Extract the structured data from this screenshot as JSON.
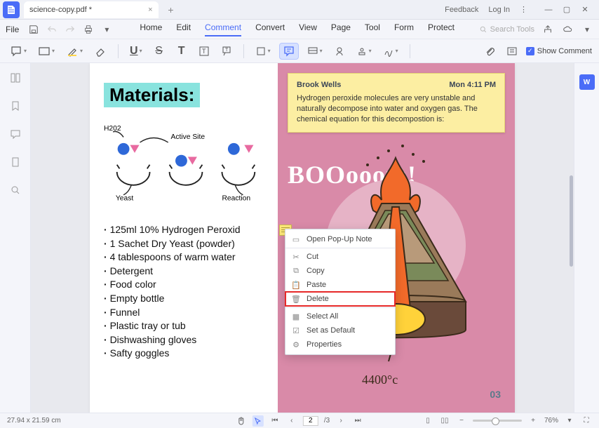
{
  "title_bar": {
    "tab_name": "science-copy.pdf *",
    "feedback": "Feedback",
    "login": "Log In"
  },
  "menubar": {
    "file": "File",
    "tabs": {
      "home": "Home",
      "edit": "Edit",
      "comment": "Comment",
      "convert": "Convert",
      "view": "View",
      "page": "Page",
      "tool": "Tool",
      "form": "Form",
      "protect": "Protect"
    },
    "search_placeholder": "Search Tools"
  },
  "toolbar": {
    "show_comment": "Show Comment"
  },
  "document": {
    "heading": "Materials:",
    "sketch_labels": {
      "h2o2": "H202",
      "active_site": "Active Site",
      "yeast": "Yeast",
      "reaction": "Reaction"
    },
    "list": [
      "125ml 10% Hydrogen Peroxid",
      "1 Sachet Dry Yeast (powder)",
      "4 tablespoons of warm water",
      "Detergent",
      "Food color",
      "Empty bottle",
      "Funnel",
      "Plastic tray or tub",
      "Dishwashing gloves",
      "Safty goggles"
    ],
    "note": {
      "author": "Brook Wells",
      "time": "Mon 4:11 PM",
      "body": "Hydrogen peroxide molecules are very unstable and naturally decompose into water and oxygen gas. The chemical equation for this decompostion is:"
    },
    "boom": "BOOooom!",
    "temp": "4400°c",
    "page_num": "03"
  },
  "context_menu": {
    "open": "Open Pop-Up Note",
    "cut": "Cut",
    "copy": "Copy",
    "paste": "Paste",
    "delete": "Delete",
    "select_all": "Select All",
    "default": "Set as Default",
    "properties": "Properties"
  },
  "statusbar": {
    "dims": "27.94 x 21.59 cm",
    "page_current": "2",
    "page_total": "/3",
    "zoom": "76%"
  }
}
